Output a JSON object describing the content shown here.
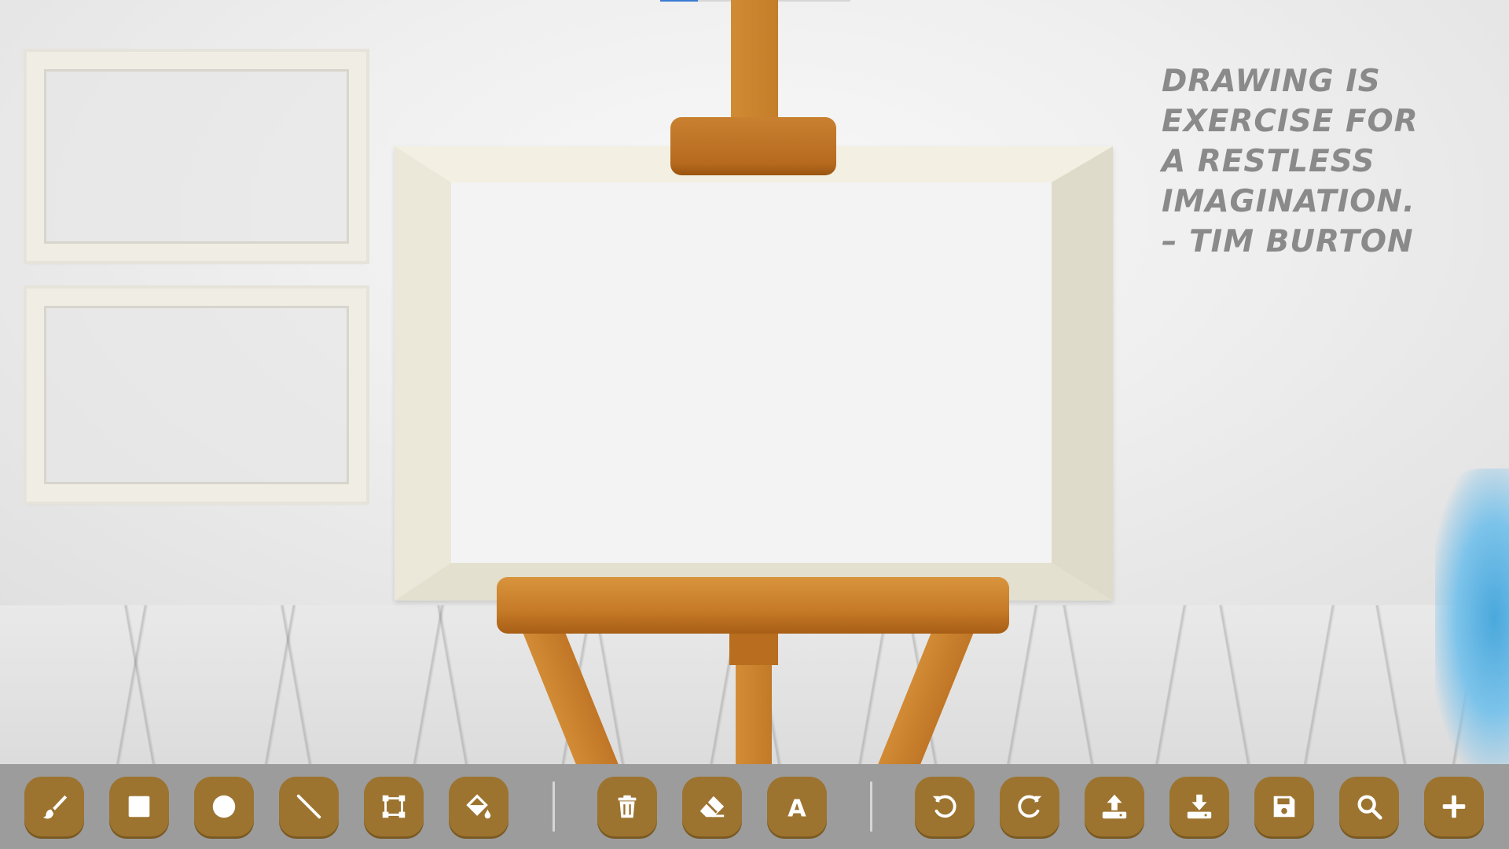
{
  "app": {
    "quote": {
      "lines": [
        "DRAWING IS",
        "EXERCISE FOR",
        "A RESTLESS",
        "IMAGINATION.",
        "– TIM BURTON"
      ]
    }
  },
  "toolbar": {
    "tools": [
      {
        "id": "brush",
        "icon": "paintbrush-icon"
      },
      {
        "id": "rectangle",
        "icon": "square-icon"
      },
      {
        "id": "circle",
        "icon": "circle-icon"
      },
      {
        "id": "line",
        "icon": "line-icon"
      },
      {
        "id": "shape",
        "icon": "vector-square-icon"
      },
      {
        "id": "fill",
        "icon": "fill-bucket-icon"
      },
      {
        "id": "delete",
        "icon": "trash-icon"
      },
      {
        "id": "eraser",
        "icon": "eraser-icon"
      },
      {
        "id": "text",
        "icon": "text-icon",
        "label": "A"
      },
      {
        "id": "undo",
        "icon": "undo-icon"
      },
      {
        "id": "redo",
        "icon": "redo-icon"
      },
      {
        "id": "upload",
        "icon": "upload-icon"
      },
      {
        "id": "download",
        "icon": "download-icon"
      },
      {
        "id": "save",
        "icon": "save-icon"
      },
      {
        "id": "zoom",
        "icon": "zoom-icon"
      },
      {
        "id": "add",
        "icon": "plus-icon"
      }
    ]
  },
  "colors": {
    "button": "#9c7430",
    "toolbar": "#9c9c9c",
    "icon": "#ffffff",
    "easel": "#c47d28",
    "quote_text": "#8a8a8a"
  }
}
